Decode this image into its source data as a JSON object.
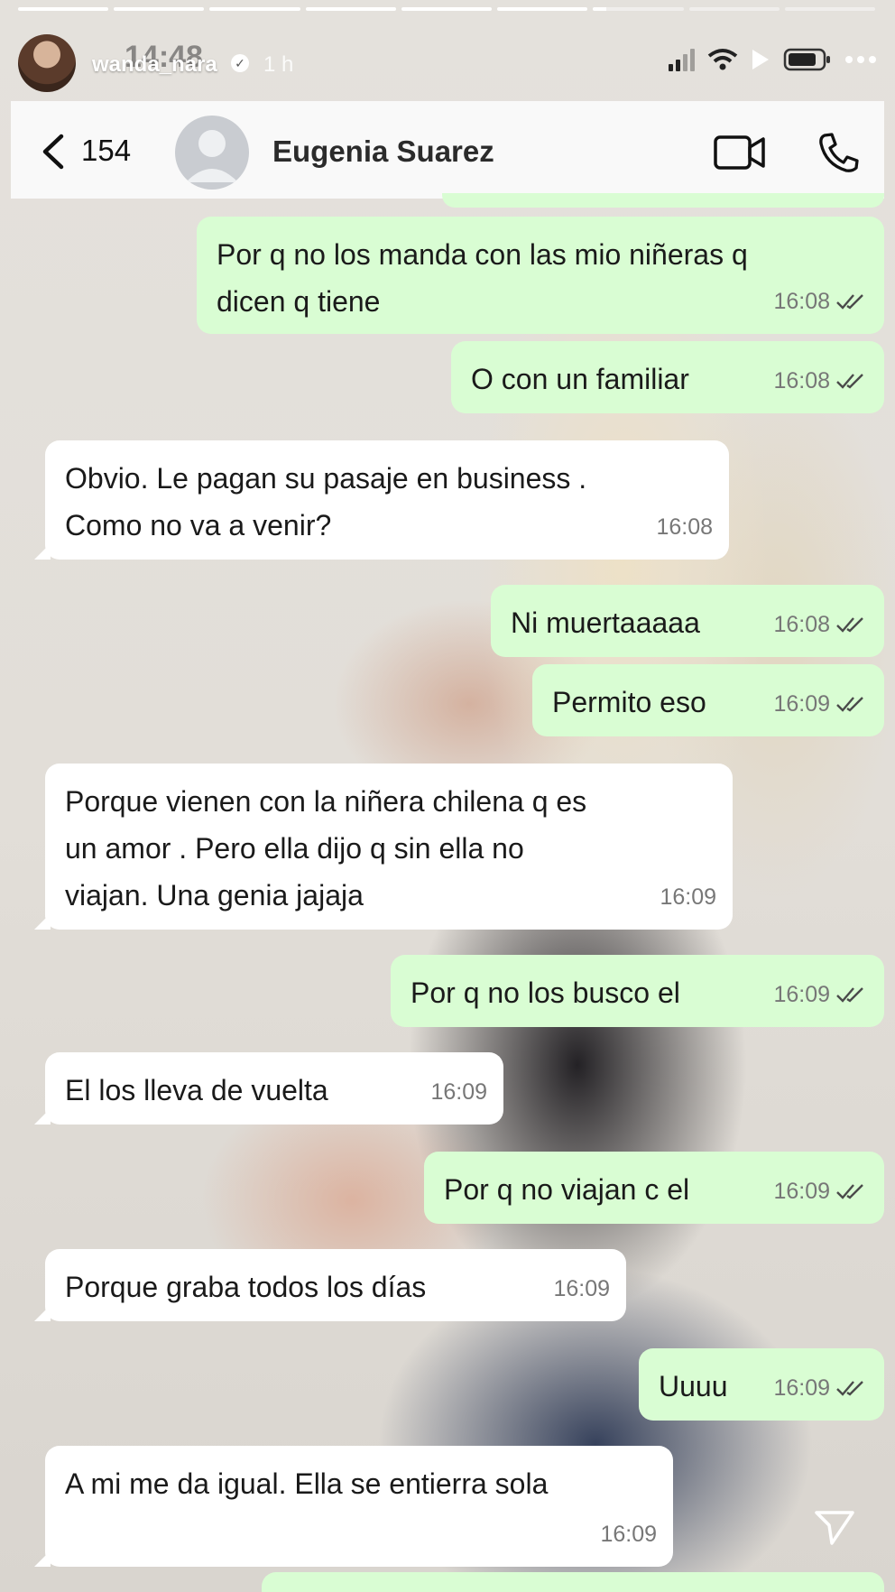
{
  "story": {
    "username": "wanda_nara",
    "time_ago": "1 h",
    "overlay_time": "14:48",
    "progress": [
      1,
      1,
      1,
      1,
      1,
      1,
      0.15,
      0,
      0
    ]
  },
  "chat": {
    "unread_count": "154",
    "contact_name": "Eugenia Suarez"
  },
  "messages": [
    {
      "dir": "out",
      "lines": [
        "Por q no los manda con las mio niñeras q",
        "dicen q tiene"
      ],
      "time": "16:08",
      "read": true
    },
    {
      "dir": "out",
      "lines": [
        "O con un familiar"
      ],
      "time": "16:08",
      "read": true
    },
    {
      "dir": "in",
      "lines": [
        "Obvio. Le pagan su pasaje en business .",
        "Como no va a venir?"
      ],
      "time": "16:08"
    },
    {
      "dir": "out",
      "lines": [
        "Ni muertaaaaa"
      ],
      "time": "16:08",
      "read": true
    },
    {
      "dir": "out",
      "lines": [
        "Permito eso"
      ],
      "time": "16:09",
      "read": true
    },
    {
      "dir": "in",
      "lines": [
        "Porque vienen con la niñera chilena q es",
        "un amor . Pero ella dijo q sin ella no",
        "viajan. Una genia jajaja"
      ],
      "time": "16:09"
    },
    {
      "dir": "out",
      "lines": [
        "Por q no los busco el"
      ],
      "time": "16:09",
      "read": true
    },
    {
      "dir": "in",
      "lines": [
        "El los lleva de vuelta"
      ],
      "time": "16:09"
    },
    {
      "dir": "out",
      "lines": [
        "Por q no viajan c el"
      ],
      "time": "16:09",
      "read": true
    },
    {
      "dir": "in",
      "lines": [
        "Porque graba todos los días"
      ],
      "time": "16:09"
    },
    {
      "dir": "out",
      "lines": [
        "Uuuu"
      ],
      "time": "16:09",
      "read": true
    },
    {
      "dir": "in",
      "lines": [
        "A mi me da igual. Ella se entierra sola"
      ],
      "time": "16:09"
    }
  ],
  "icons": {
    "back": "chevron-left-icon",
    "video": "video-camera-icon",
    "call": "phone-icon",
    "send": "paper-plane-icon",
    "verified": "verified-badge-icon"
  },
  "colors": {
    "outgoing_bubble": "#d9fdd3",
    "incoming_bubble": "#ffffff",
    "header_bg": "#fafafa"
  }
}
